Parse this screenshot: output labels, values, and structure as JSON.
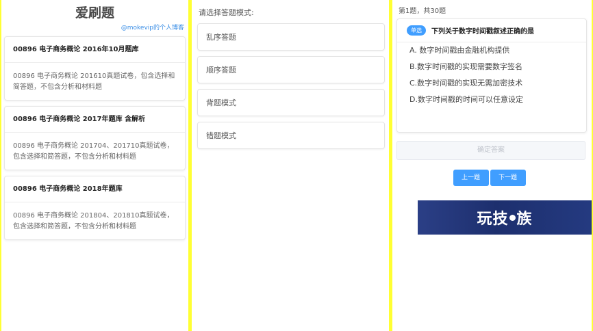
{
  "left_panel": {
    "app_title": "爱刷题",
    "app_subtitle": "@mokevip的个人博客",
    "question_banks": [
      {
        "title": "00896 电子商务概论 2016年10月题库",
        "description": "00896 电子商务概论 201610真题试卷，包含选择和简答题，不包含分析和材料题"
      },
      {
        "title": "00896 电子商务概论 2017年题库 含解析",
        "description": "00896 电子商务概论 201704、201710真题试卷，包含选择和简答题，不包含分析和材料题"
      },
      {
        "title": "00896 电子商务概论 2018年题库",
        "description": "00896 电子商务概论 201804、201810真题试卷，包含选择和简答题，不包含分析和材料题"
      }
    ]
  },
  "middle_panel": {
    "prompt": "请选择答题模式:",
    "modes": [
      "乱序答题",
      "顺序答题",
      "背题模式",
      "错题模式"
    ]
  },
  "right_panel": {
    "progress": "第1题，共30题",
    "question_type": "单选",
    "question_text": "下列关于数字时间戳叙述正确的是",
    "options": [
      "A. 数字时间戳由金融机构提供",
      "B.数字时间戳的实现需要数字签名",
      "C.数字时间戳的实现无需加密技术",
      "D.数字时间戳的时间可以任意设定"
    ],
    "confirm_label": "确定答案",
    "prev_label": "上一题",
    "next_label": "下一题"
  },
  "watermark": {
    "text_before": "玩技",
    "text_after": "族"
  },
  "colors": {
    "frame": "#ffff33",
    "accent": "#409eff",
    "logo_bg": "#243a80"
  }
}
